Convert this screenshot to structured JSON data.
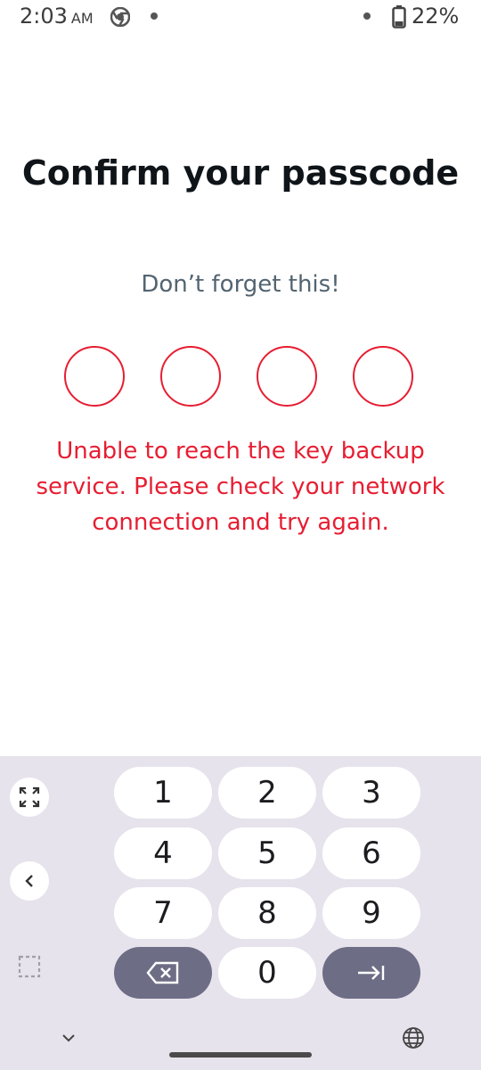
{
  "status_bar": {
    "time": "2:03",
    "ampm": "AM",
    "battery": "22%"
  },
  "screen": {
    "title": "Confirm your passcode",
    "subtitle": "Don’t forget this!",
    "error": "Unable to reach the key backup service. Please check your network connection and try again."
  },
  "keypad": {
    "keys": [
      "1",
      "2",
      "3",
      "4",
      "5",
      "6",
      "7",
      "8",
      "9",
      "0"
    ]
  },
  "colors": {
    "error": "#e61e32",
    "keyboard_bg": "#e6e3ec",
    "dark_key": "#6e6d86"
  }
}
